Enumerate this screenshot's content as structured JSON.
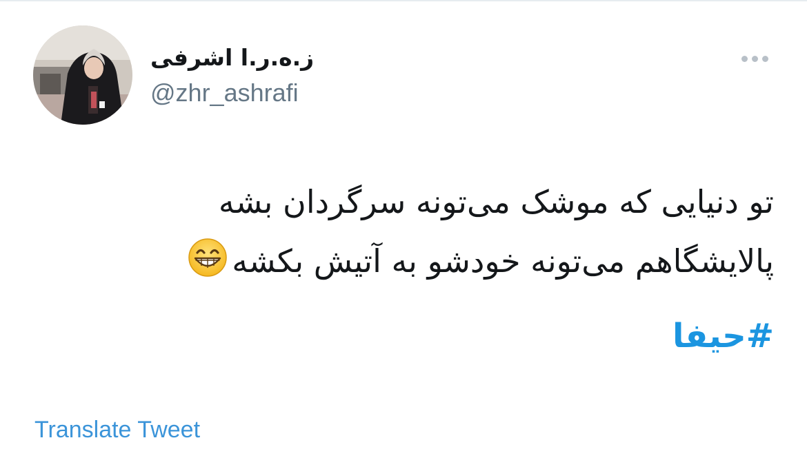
{
  "tweet": {
    "author": {
      "display_name": "ز.ه.ر.ا اشرفی",
      "handle": "@zhr_ashrafi",
      "avatar_icon": "user-avatar-photo"
    },
    "more_icon": "more-options-dots-icon",
    "text_lines": [
      "تو دنیایی که موشک می‌تونه سرگردان بشه",
      "پالایشگاهم می‌تونه خودشو به آتیش بکشه"
    ],
    "emoji": "grinning-face-with-smiling-eyes",
    "hashtag": "#حیفا",
    "translate_label": "Translate Tweet",
    "colors": {
      "link": "#1b95e0",
      "text": "#14171a",
      "muted": "#657786"
    }
  }
}
